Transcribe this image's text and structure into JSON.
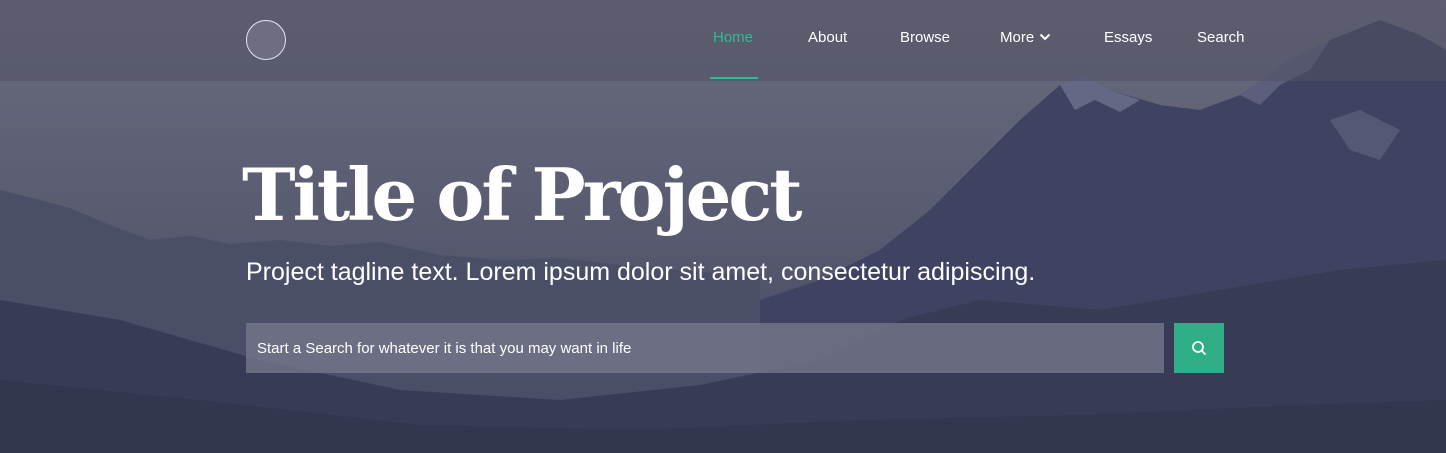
{
  "nav": {
    "items": [
      {
        "label": "Home",
        "active": true
      },
      {
        "label": "About"
      },
      {
        "label": "Browse"
      },
      {
        "label": "More",
        "has_dropdown": true
      },
      {
        "label": "Essays"
      },
      {
        "label": "Search"
      }
    ]
  },
  "hero": {
    "title": "Title of Project",
    "tagline": "Project tagline text. Lorem ipsum dolor sit amet, consectetur adipiscing."
  },
  "search": {
    "placeholder": "Start a Search for whatever it is that you may want in life",
    "button_icon": "search-icon"
  },
  "colors": {
    "accent": "#2dbb93",
    "search_button": "#2fae87"
  }
}
